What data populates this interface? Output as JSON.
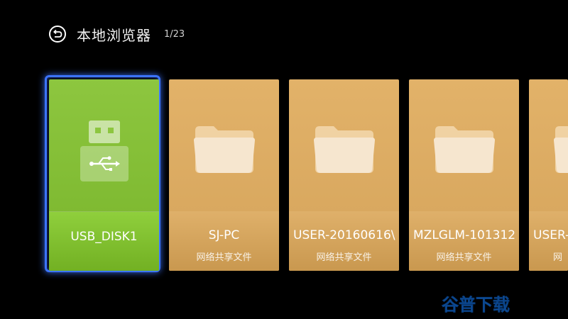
{
  "header": {
    "title": "本地浏览器",
    "page_indicator": "1/23",
    "back_icon": "back-icon"
  },
  "tiles": [
    {
      "label": "USB_DISK1",
      "subtitle": "",
      "icon": "usb-drive-icon",
      "focused": true,
      "color": "#8dc63f"
    },
    {
      "label": "SJ-PC",
      "subtitle": "网络共享文件",
      "icon": "folder-icon",
      "focused": false,
      "color": "#e2b269"
    },
    {
      "label": "USER-20160616\\",
      "subtitle": "网络共享文件",
      "icon": "folder-icon",
      "focused": false,
      "color": "#e2b269"
    },
    {
      "label": "MZLGLM-101312",
      "subtitle": "网络共享文件",
      "icon": "folder-icon",
      "focused": false,
      "color": "#e2b269"
    },
    {
      "label": "USER-",
      "subtitle": "网",
      "icon": "folder-icon",
      "focused": false,
      "color": "#e2b269"
    }
  ],
  "watermark": {
    "text": "谷普下载"
  },
  "colors": {
    "focus": "#3c74ff",
    "usb_green": "#8dc63f",
    "folder_gold": "#e2b269",
    "background": "#000000"
  }
}
